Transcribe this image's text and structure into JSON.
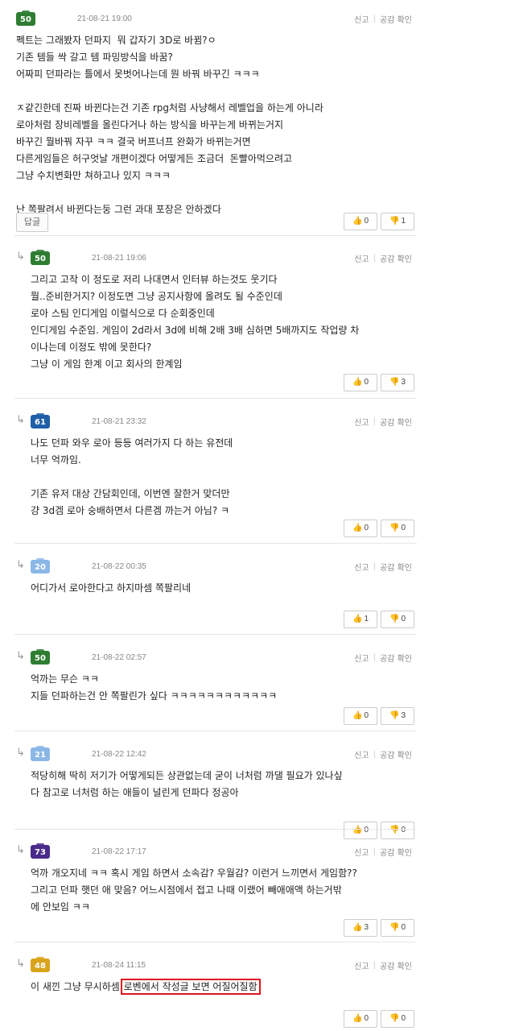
{
  "colors": {
    "badge_green": "#2e7d32",
    "badge_blue": "#1f5fa8",
    "badge_lightblue": "#8bb7e6",
    "badge_purple": "#4a2a8a",
    "badge_gold": "#d9a41c",
    "like_red": "#e2443c",
    "dislike_blue": "#3d7bd8",
    "highlight_red": "#e0141e"
  },
  "labels": {
    "report": "신고",
    "sep": "|",
    "empathy": "공감 확인",
    "reply": "답글",
    "up_icon": "👍",
    "down_icon": "👎",
    "reply_arrow": "↳"
  },
  "comments": [
    {
      "level": "50",
      "date": "21-08-21 19:00",
      "lines": [
        "펙트는 그래봤자 던파지  뭐 갑자기 3D로 바뀜?ㅇ",
        "기존 템들 싹 갈고 템 파밍방식을 바꿈?",
        "어짜피 던파라는 틀에서 못벗어나는데 뭔 바꿔 바꾸긴 ㅋㅋㅋ",
        "",
        "ㅈ같긴한데 진짜 바뀐다는건 기존 rpg처럼 사냥해서 레벨업을 하는게 아니라",
        "로아처럼 장비레벨을 올린다거나 하는 방식을 바꾸는게 바뀌는거지",
        "바꾸긴 뭘바꿔 자꾸 ㅋㅋ 결국 버프너프 완화가 바뀌는거면",
        "다른게임들은 허구엇날 개편이겠다 어떻게든 조금더  돈빨아먹으려고",
        "그냥 수치변화만 쳐하고나 있지 ㅋㅋㅋ",
        "",
        "난 쪽팔려서 바뀐다는둥 그런 과대 포장은 안하겠다"
      ],
      "up": "0",
      "down": "1"
    },
    {
      "level": "50",
      "date": "21-08-21 19:06",
      "lines": [
        "그리고 고작 이 정도로 저리 나대면서 인터뷰 하는것도 웃기다",
        "뭘..준비한거지? 이정도면 그냥 공지사항에 올려도 될 수준인데",
        "로아 스팀 인디게임 이럴식으로 다 순회중인데",
        "인디게임 수준임. 게임이 2d라서 3d에 비해 2배 3배 심하면 5배까지도 작업량 차",
        "이나는데 이정도 밖에 못한다?",
        "그냥 이 게임 한계 이고 회사의 한계임"
      ],
      "up": "0",
      "down": "3"
    },
    {
      "level": "61",
      "date": "21-08-21 23:32",
      "lines": [
        "나도 던파 와우 로아 등등 여러가지 다 하는 유전데",
        "너무 억까임.",
        "",
        "기존 유저 대상 간담회인데, 이번엔 잘한거 맞더만",
        "걍 3d겜 로아 숭배하면서 다른겜 까는거 아님? ㅋ"
      ],
      "up": "0",
      "down": "0"
    },
    {
      "level": "20",
      "date": "21-08-22 00:35",
      "lines": [
        "어디가서 로아한다고 하지마셈 쪽팔리네"
      ],
      "up": "1",
      "down": "0"
    },
    {
      "level": "50",
      "date": "21-08-22 02:57",
      "lines": [
        "억까는 무슨 ㅋㅋ",
        "지들 던파하는건 안 쪽팔린가 싶다 ㅋㅋㅋㅋㅋㅋㅋㅋㅋㅋㅋㅋ"
      ],
      "up": "0",
      "down": "3"
    },
    {
      "level": "21",
      "date": "21-08-22 12:42",
      "lines": [
        "적당히해 딱히 저기가 어떻게되든 상관없는데 굳이 너처럼 까댈 필요가 있나싶",
        "다 참고로 너처럼 하는 애들이 널린게 던파다 정공아"
      ],
      "up": "0",
      "down": "0"
    },
    {
      "level": "73",
      "date": "21-08-22 17:17",
      "lines": [
        "억까 개오지네 ㅋㅋ 혹시 게임 하면서 소속감? 우월감? 이런거 느끼면서 게임함??",
        "그리고 던파 햇던 애 맞음? 어느시점에서 접고 나때 이랬어 빼애애액 하는거밖",
        "에 안보임 ㅋㅋ"
      ],
      "up": "3",
      "down": "0"
    },
    {
      "level": "48",
      "date": "21-08-24 11:15",
      "lines": [
        "이 새낀 그냥 무시하셈 "
      ],
      "highlight": "로벤에서 작성글 보면 어질어질함",
      "up": "0",
      "down": "0"
    }
  ]
}
